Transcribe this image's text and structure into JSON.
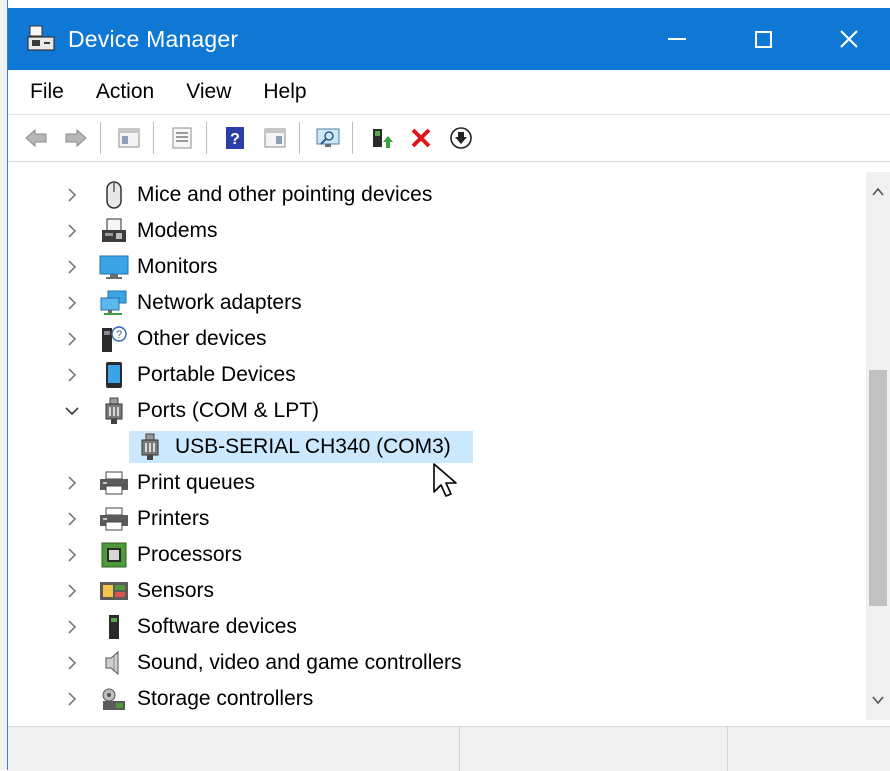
{
  "window": {
    "title": "Device Manager",
    "accent": "#0f78d4"
  },
  "menubar": {
    "items": [
      "File",
      "Action",
      "View",
      "Help"
    ]
  },
  "toolbar": {
    "buttons": [
      "back-arrow-icon",
      "forward-arrow-icon",
      "show-hide-console-tree-icon",
      "properties-icon",
      "help-icon",
      "action-pane-icon",
      "scan-hardware-icon",
      "update-driver-icon",
      "uninstall-icon",
      "disable-device-icon"
    ]
  },
  "tree": {
    "items": [
      {
        "label": "Mice and other pointing devices",
        "icon": "mouse-icon",
        "expanded": false
      },
      {
        "label": "Modems",
        "icon": "modem-icon",
        "expanded": false
      },
      {
        "label": "Monitors",
        "icon": "monitor-icon",
        "expanded": false
      },
      {
        "label": "Network adapters",
        "icon": "network-adapter-icon",
        "expanded": false
      },
      {
        "label": "Other devices",
        "icon": "unknown-device-icon",
        "expanded": false
      },
      {
        "label": "Portable Devices",
        "icon": "portable-device-icon",
        "expanded": false
      },
      {
        "label": "Ports (COM & LPT)",
        "icon": "port-icon",
        "expanded": true
      },
      {
        "label": "USB-SERIAL CH340 (COM3)",
        "icon": "port-icon",
        "child": true,
        "selected": true
      },
      {
        "label": "Print queues",
        "icon": "printer-icon",
        "expanded": false
      },
      {
        "label": "Printers",
        "icon": "printer-icon",
        "expanded": false
      },
      {
        "label": "Processors",
        "icon": "processor-icon",
        "expanded": false
      },
      {
        "label": "Sensors",
        "icon": "sensor-icon",
        "expanded": false
      },
      {
        "label": "Software devices",
        "icon": "software-device-icon",
        "expanded": false
      },
      {
        "label": "Sound, video and game controllers",
        "icon": "speaker-icon",
        "expanded": false
      },
      {
        "label": "Storage controllers",
        "icon": "storage-controller-icon",
        "expanded": false
      }
    ]
  },
  "statusbar": {
    "panes": [
      "",
      "",
      ""
    ]
  }
}
